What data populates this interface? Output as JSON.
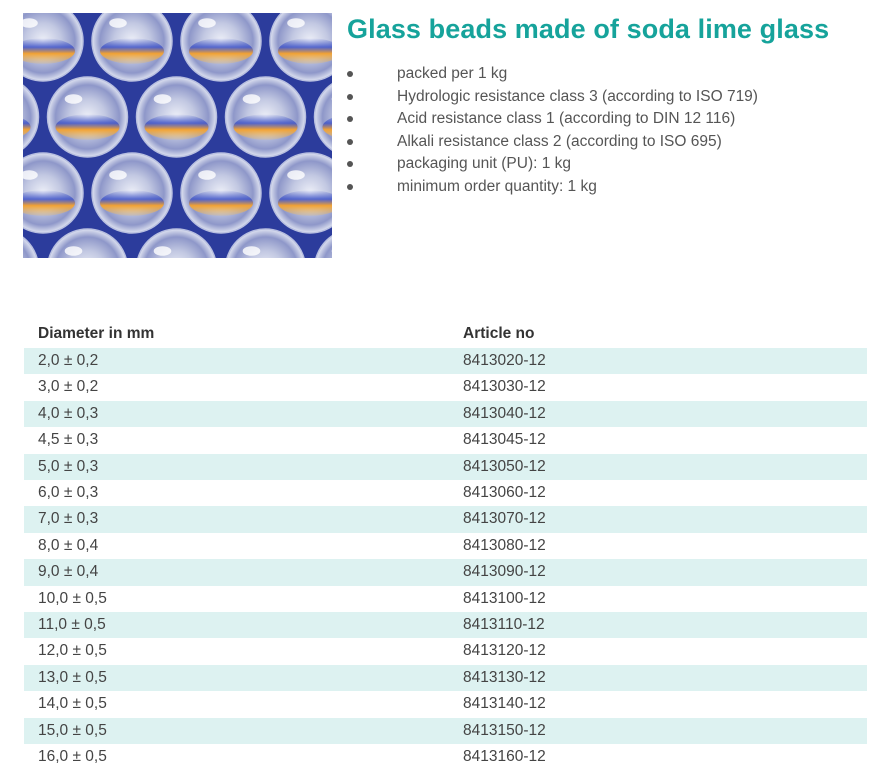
{
  "product": {
    "title": "Glass beads made of soda lime glass",
    "features": [
      "packed per 1 kg",
      "Hydrologic resistance class 3 (according to ISO 719)",
      "Acid resistance class 1 (according to DIN 12 116)",
      "Alkali resistance class 2 (according to ISO 695)",
      "packaging unit (PU): 1 kg",
      "minimum order quantity: 1 kg"
    ],
    "image_icon": "glass-beads-photo"
  },
  "colors": {
    "title": "#16a39b",
    "row_stripe": "#ddf2f1",
    "image_bg": "#2c3c9c",
    "bead_orange": "#f2a233"
  },
  "table": {
    "headers": [
      "Diameter in mm",
      "Article no"
    ],
    "rows": [
      [
        "2,0 ± 0,2",
        "8413020-12"
      ],
      [
        "3,0 ± 0,2",
        "8413030-12"
      ],
      [
        "4,0 ± 0,3",
        "8413040-12"
      ],
      [
        "4,5 ± 0,3",
        "8413045-12"
      ],
      [
        "5,0 ± 0,3",
        "8413050-12"
      ],
      [
        "6,0 ± 0,3",
        "8413060-12"
      ],
      [
        "7,0 ± 0,3",
        "8413070-12"
      ],
      [
        "8,0 ± 0,4",
        "8413080-12"
      ],
      [
        "9,0 ± 0,4",
        "8413090-12"
      ],
      [
        "10,0 ± 0,5",
        "8413100-12"
      ],
      [
        "11,0 ± 0,5",
        "8413110-12"
      ],
      [
        "12,0 ± 0,5",
        "8413120-12"
      ],
      [
        "13,0 ± 0,5",
        "8413130-12"
      ],
      [
        "14,0 ± 0,5",
        "8413140-12"
      ],
      [
        "15,0 ± 0,5",
        "8413150-12"
      ],
      [
        "16,0 ± 0,5",
        "8413160-12"
      ]
    ]
  }
}
